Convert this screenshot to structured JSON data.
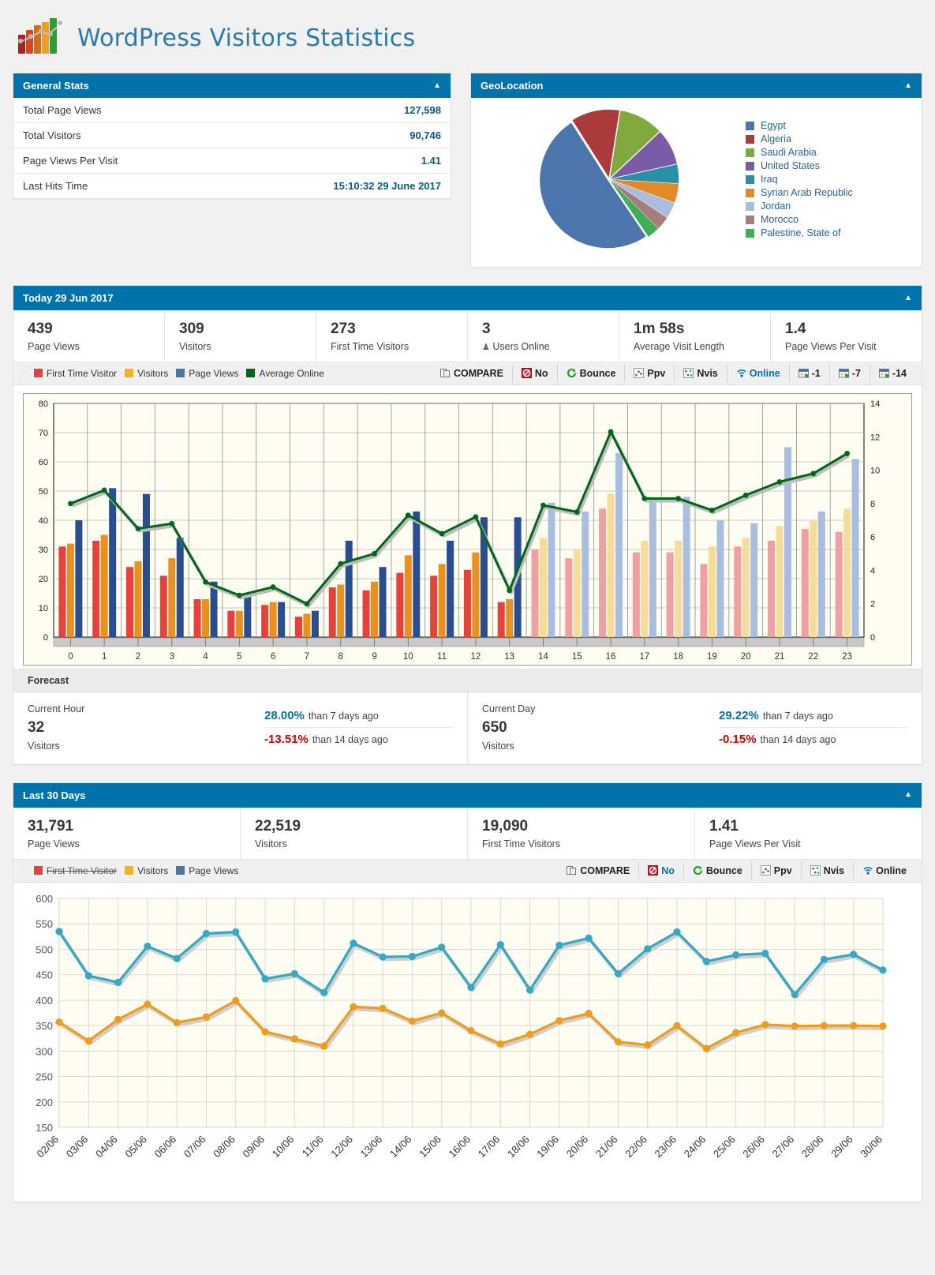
{
  "app": {
    "title": "WordPress Visitors Statistics",
    "logo_icon": "bar-chart-logo-icon"
  },
  "general_stats": {
    "title": "General Stats",
    "collapse_icon": "caret-up-icon",
    "rows": [
      {
        "label": "Total Page Views",
        "value": "127,598"
      },
      {
        "label": "Total Visitors",
        "value": "90,746"
      },
      {
        "label": "Page Views Per Visit",
        "value": "1.41"
      },
      {
        "label": "Last Hits Time",
        "value": "15:10:32 29 June 2017"
      }
    ]
  },
  "geolocation": {
    "title": "GeoLocation",
    "collapse_icon": "caret-up-icon",
    "chart_data": {
      "type": "pie",
      "title": "GeoLocation",
      "labels": [
        "Egypt",
        "Algeria",
        "Saudi Arabia",
        "United States",
        "Iraq",
        "Syrian Arab Republic",
        "Jordan",
        "Morocco",
        "Palestine, State of"
      ],
      "values": [
        50.5,
        11.5,
        10.5,
        8.5,
        4.5,
        4.5,
        3.8,
        3.2,
        3.0
      ],
      "colors": [
        "#4a76ab",
        "#aa3b3b",
        "#81a83c",
        "#7a5ba8",
        "#2790a8",
        "#e08a28",
        "#a9bede",
        "#a67c7c",
        "#3fae55"
      ],
      "legend_position": "right"
    }
  },
  "today": {
    "title": "Today  29 Jun 2017",
    "collapse_icon": "caret-up-icon",
    "kpis": [
      {
        "value": "439",
        "label": "Page Views",
        "icon": ""
      },
      {
        "value": "309",
        "label": "Visitors",
        "icon": ""
      },
      {
        "value": "273",
        "label": "First Time Visitors",
        "icon": ""
      },
      {
        "value": "3",
        "label": "Users Online",
        "icon": "user-online-icon"
      },
      {
        "value": "1m 58s",
        "label": "Average Visit Length",
        "icon": ""
      },
      {
        "value": "1.4",
        "label": "Page Views Per Visit",
        "icon": ""
      }
    ],
    "toolbar": {
      "legend": [
        {
          "label": "First Time Visitor",
          "color": "#e8403a",
          "disabled": false
        },
        {
          "label": "Visitors",
          "color": "#f0b323",
          "disabled": false
        },
        {
          "label": "Page Views",
          "color": "#4a76ab",
          "disabled": false
        },
        {
          "label": "Average Online",
          "color": "#00661a",
          "disabled": false
        }
      ],
      "buttons": [
        {
          "label": "COMPARE",
          "icon": "compare-icon",
          "active": false
        },
        {
          "label": "No",
          "icon": "no-icon",
          "active": false
        },
        {
          "label": "Bounce",
          "icon": "bounce-icon",
          "active": false
        },
        {
          "label": "Ppv",
          "icon": "ppv-icon",
          "active": false
        },
        {
          "label": "Nvis",
          "icon": "nvis-icon",
          "active": false
        },
        {
          "label": "Online",
          "icon": "online-icon",
          "active": true
        },
        {
          "label": "-1",
          "icon": "calendar-icon",
          "active": false
        },
        {
          "label": "-7",
          "icon": "calendar-icon",
          "active": false
        },
        {
          "label": "-14",
          "icon": "calendar-icon",
          "active": false
        }
      ]
    },
    "chart_data": {
      "type": "bar",
      "title": "Today 29 Jun 2017 hourly traffic",
      "xlabel": "",
      "ylabel": "",
      "ylim": [
        0,
        80
      ],
      "y2lim": [
        0,
        14
      ],
      "grid": true,
      "categories": [
        "0",
        "1",
        "2",
        "3",
        "4",
        "5",
        "6",
        "7",
        "8",
        "9",
        "10",
        "11",
        "12",
        "13",
        "14",
        "15",
        "16",
        "17",
        "18",
        "19",
        "20",
        "21",
        "22",
        "23"
      ],
      "forecast_from_index": 14,
      "series": [
        {
          "name": "First Time Visitor",
          "color": "#e8403a",
          "faded_color": "#f0a0a0",
          "axis": "left",
          "values": [
            31,
            33,
            24,
            21,
            13,
            9,
            11,
            7,
            17,
            16,
            22,
            21,
            23,
            12,
            30,
            27,
            44,
            29,
            29,
            25,
            31,
            33,
            37,
            36
          ]
        },
        {
          "name": "Visitors",
          "color": "#e8911e",
          "faded_color": "#f5dc9a",
          "axis": "left",
          "values": [
            32,
            35,
            26,
            27,
            13,
            9,
            12,
            8,
            18,
            19,
            28,
            25,
            29,
            13,
            34,
            30,
            49,
            33,
            33,
            31,
            34,
            38,
            40,
            44
          ]
        },
        {
          "name": "Page Views",
          "color": "#2a4d8f",
          "faded_color": "#a9bede",
          "axis": "left",
          "values": [
            40,
            51,
            49,
            34,
            19,
            15,
            12,
            9,
            33,
            24,
            43,
            33,
            41,
            41,
            46,
            43,
            63,
            47,
            48,
            40,
            39,
            65,
            43,
            61
          ]
        },
        {
          "name": "Average Online",
          "color": "#00661a",
          "axis": "right",
          "values": [
            8.0,
            8.8,
            6.5,
            6.8,
            3.3,
            2.5,
            3.0,
            2.0,
            4.4,
            5.0,
            7.3,
            6.2,
            7.2,
            2.8,
            7.9,
            7.5,
            12.3,
            8.3,
            8.3,
            7.6,
            8.5,
            9.3,
            9.8,
            11.0
          ]
        }
      ]
    },
    "forecast": {
      "title": "Forecast",
      "items": [
        {
          "title": "Current Hour",
          "value": "32",
          "sub": "Visitors",
          "lines": [
            {
              "pct": "28.00%",
              "text": "than 7 days ago",
              "positive": true
            },
            {
              "pct": "-13.51%",
              "text": "than 14 days ago",
              "positive": false
            }
          ]
        },
        {
          "title": "Current Day",
          "value": "650",
          "sub": "Visitors",
          "lines": [
            {
              "pct": "29.22%",
              "text": "than 7 days ago",
              "positive": true
            },
            {
              "pct": "-0.15%",
              "text": "than 14 days ago",
              "positive": false
            }
          ]
        }
      ]
    }
  },
  "last30": {
    "title": "Last 30 Days",
    "collapse_icon": "caret-up-icon",
    "kpis": [
      {
        "value": "31,791",
        "label": "Page Views"
      },
      {
        "value": "22,519",
        "label": "Visitors"
      },
      {
        "value": "19,090",
        "label": "First Time Visitors"
      },
      {
        "value": "1.41",
        "label": "Page Views Per Visit"
      }
    ],
    "toolbar": {
      "legend": [
        {
          "label": "First Time Visitor",
          "color": "#e8403a",
          "disabled": true
        },
        {
          "label": "Visitors",
          "color": "#f0b323",
          "disabled": false
        },
        {
          "label": "Page Views",
          "color": "#4a76ab",
          "disabled": false
        }
      ],
      "buttons": [
        {
          "label": "COMPARE",
          "icon": "compare-icon",
          "active": false
        },
        {
          "label": "No",
          "icon": "no-icon",
          "active": true
        },
        {
          "label": "Bounce",
          "icon": "bounce-icon",
          "active": false
        },
        {
          "label": "Ppv",
          "icon": "ppv-icon",
          "active": false
        },
        {
          "label": "Nvis",
          "icon": "nvis-icon",
          "active": false
        },
        {
          "label": "Online",
          "icon": "online-icon",
          "active": false
        }
      ]
    },
    "chart_data": {
      "type": "line",
      "title": "Last 30 Days",
      "xlabel": "",
      "ylabel": "",
      "ylim": [
        150,
        600
      ],
      "yticks": [
        150,
        200,
        250,
        300,
        350,
        400,
        450,
        500,
        550,
        600
      ],
      "grid": true,
      "categories": [
        "02/06",
        "03/06",
        "04/06",
        "05/06",
        "06/06",
        "07/06",
        "08/06",
        "09/06",
        "10/06",
        "11/06",
        "12/06",
        "13/06",
        "14/06",
        "15/06",
        "16/06",
        "17/06",
        "18/06",
        "19/06",
        "20/06",
        "21/06",
        "22/06",
        "23/06",
        "24/06",
        "25/06",
        "26/06",
        "27/06",
        "28/06",
        "29/06",
        "30/06"
      ],
      "series": [
        {
          "name": "Page Views",
          "color": "#35a8c4",
          "values": [
            535,
            448,
            435,
            506,
            482,
            531,
            534,
            442,
            452,
            415,
            512,
            485,
            486,
            504,
            425,
            509,
            420,
            508,
            522,
            452,
            501,
            534,
            476,
            489,
            492,
            411,
            480,
            490,
            459
          ]
        },
        {
          "name": "Visitors",
          "color": "#ef9c1e",
          "values": [
            357,
            320,
            362,
            392,
            356,
            367,
            399,
            338,
            324,
            310,
            387,
            384,
            359,
            375,
            340,
            314,
            333,
            360,
            374,
            318,
            312,
            350,
            305,
            336,
            352,
            349,
            350,
            350,
            349
          ]
        }
      ]
    }
  }
}
